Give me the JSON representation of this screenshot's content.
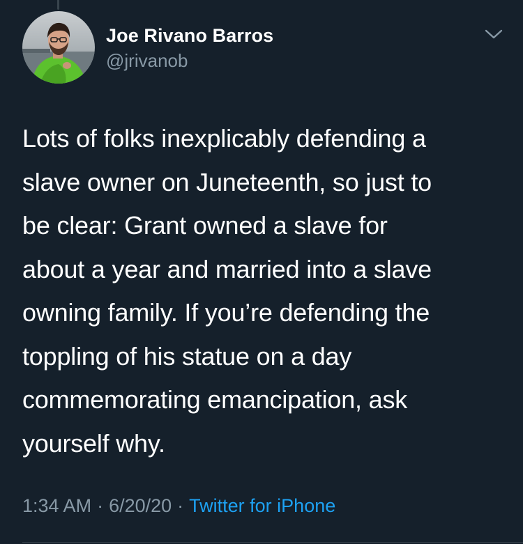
{
  "tweet": {
    "author": {
      "display_name": "Joe Rivano Barros",
      "handle": "@jrivanob"
    },
    "menu_icon": "chevron-down-icon",
    "avatar_icon": "avatar",
    "body_lines": [
      "Lots of folks inexplicably defending a",
      "slave owner on Juneteenth, so just to",
      "be clear: Grant owned a slave for",
      "about a year and married into a slave",
      "owning family. If you’re defending the",
      "toppling of his statue on a day",
      "commemorating emancipation, ask",
      "yourself why."
    ],
    "time": "1:34 AM",
    "date": "6/20/20",
    "separator": "·",
    "source": "Twitter for iPhone"
  },
  "colors": {
    "background": "#15202b",
    "text": "#ffffff",
    "muted": "#8899a6",
    "link": "#1da1f2",
    "divider": "#38444d"
  }
}
